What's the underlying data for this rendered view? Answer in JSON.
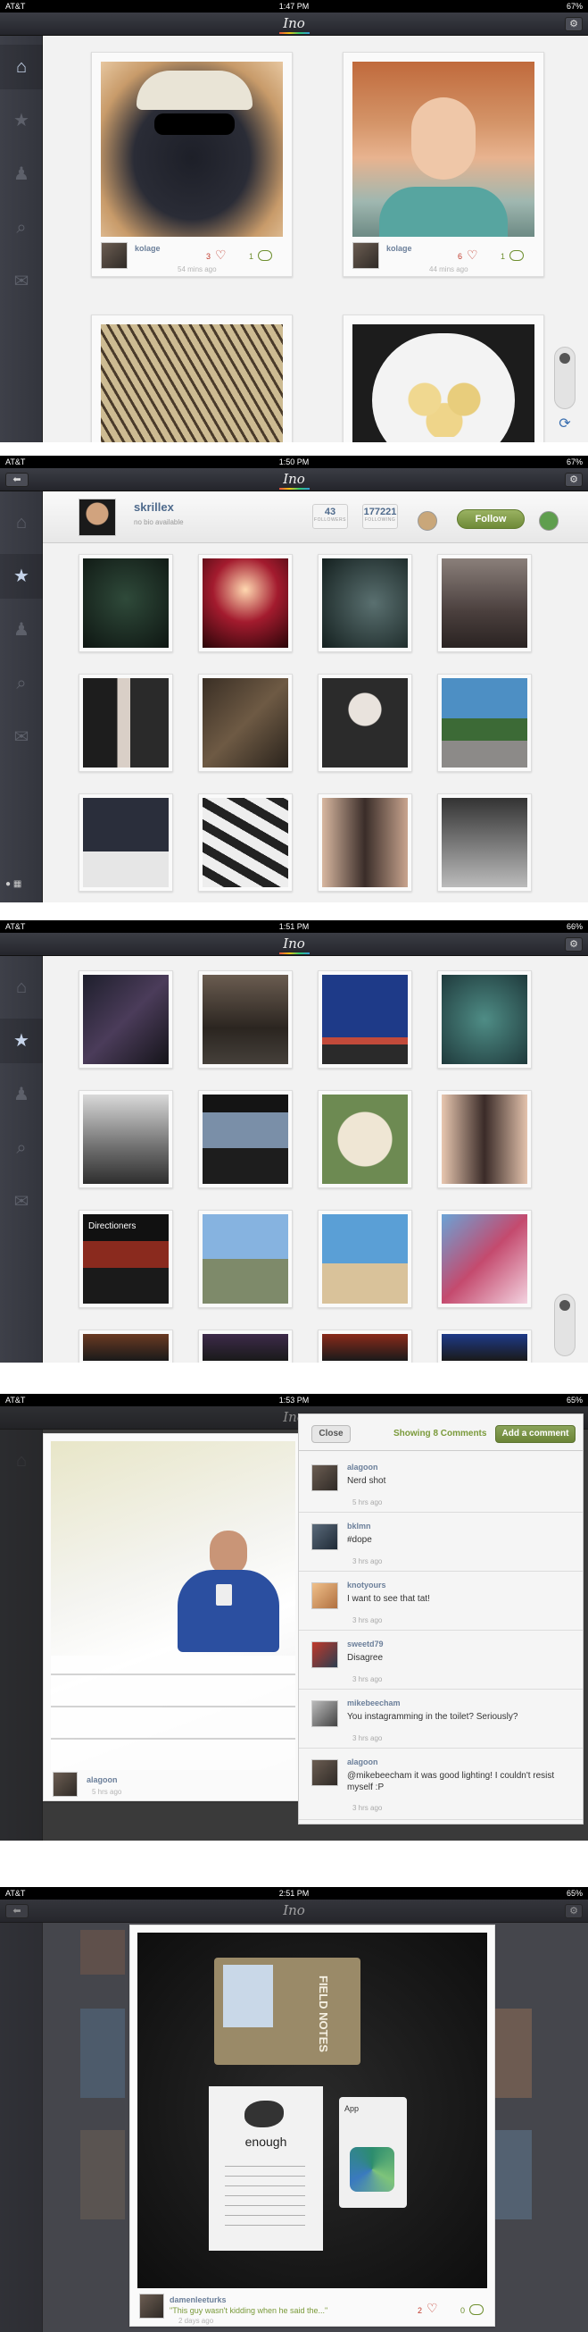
{
  "app": {
    "logo": "Ino",
    "gear_glyph": "⚙",
    "back_glyph": "⬅"
  },
  "shots": [
    {
      "status": {
        "carrier": "AT&T",
        "time": "1:47 PM",
        "battery": "67%"
      },
      "feed": [
        {
          "username": "kolage",
          "likes": "3",
          "comments": "1",
          "time": "54 mins ago"
        },
        {
          "username": "kolage",
          "likes": "6",
          "comments": "1",
          "time": "44 mins ago"
        }
      ]
    },
    {
      "status": {
        "carrier": "AT&T",
        "time": "1:50 PM",
        "battery": "67%"
      },
      "profile": {
        "username": "skrillex",
        "bio": "no bio available",
        "followers_count": "43",
        "followers_label": "FOLLOWERS",
        "following_count": "177221",
        "following_label": "FOLLOWING",
        "follow_label": "Follow"
      }
    },
    {
      "status": {
        "carrier": "AT&T",
        "time": "1:51 PM",
        "battery": "66%"
      },
      "grid_caption": "Directioners"
    },
    {
      "status": {
        "carrier": "AT&T",
        "time": "1:53 PM",
        "battery": "65%"
      },
      "photo": {
        "username": "alagoon",
        "time": "5 hrs ago"
      },
      "comments_panel": {
        "close_label": "Close",
        "showing_label": "Showing 8 Comments",
        "add_label": "Add a comment",
        "items": [
          {
            "user": "alagoon",
            "text": "Nerd shot",
            "time": "5 hrs ago"
          },
          {
            "user": "bklmn",
            "text": "#dope",
            "time": "3 hrs ago"
          },
          {
            "user": "knotyours",
            "text": "I want to see that tat!",
            "time": "3 hrs ago"
          },
          {
            "user": "sweetd79",
            "text": "Disagree",
            "time": "3 hrs ago"
          },
          {
            "user": "mikebeecham",
            "text": "You instagramming in the toilet? Seriously?",
            "time": "3 hrs ago"
          },
          {
            "user": "alagoon",
            "text": "@mikebeecham it was good lighting! I couldn't resist myself :P",
            "time": "3 hrs ago"
          }
        ]
      }
    },
    {
      "status": {
        "carrier": "AT&T",
        "time": "2:51 PM",
        "battery": "65%"
      },
      "photo": {
        "username": "damenleeturks",
        "caption": "\"This guy wasn't kidding when he said the...\"",
        "time": "2 days ago",
        "likes": "2",
        "comments": "0",
        "notebook_title": "FIELD NOTES",
        "card_title": "enough",
        "app_label": "App"
      }
    }
  ]
}
